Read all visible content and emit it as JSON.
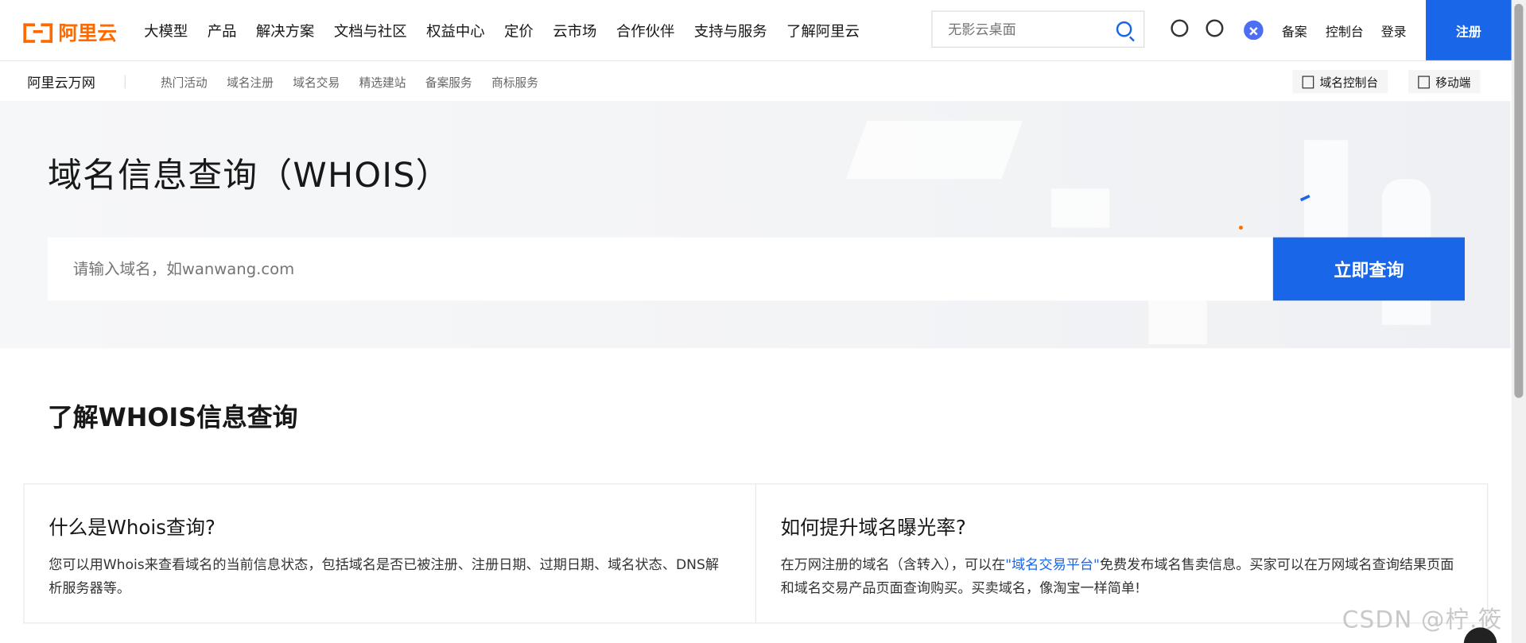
{
  "brand": {
    "name": "阿里云"
  },
  "nav": [
    "大模型",
    "产品",
    "解决方案",
    "文档与社区",
    "权益中心",
    "定价",
    "云市场",
    "合作伙伴",
    "支持与服务",
    "了解阿里云"
  ],
  "search": {
    "placeholder": "无影云桌面"
  },
  "toplinks": {
    "beian": "备案",
    "console": "控制台",
    "login": "登录",
    "signup": "注册"
  },
  "subbar": {
    "brand": "阿里云万网",
    "items": [
      "热门活动",
      "域名注册",
      "域名交易",
      "精选建站",
      "备案服务",
      "商标服务"
    ],
    "domain_console": "域名控制台",
    "mobile": "移动端"
  },
  "hero": {
    "title": "域名信息查询（WHOIS）",
    "placeholder": "请输入域名，如wanwang.com",
    "button": "立即查询"
  },
  "section": {
    "title": "了解WHOIS信息查询"
  },
  "cards": [
    {
      "title": "什么是Whois查询?",
      "text": "您可以用Whois来查看域名的当前信息状态，包括域名是否已被注册、注册日期、过期日期、域名状态、DNS解析服务器等。"
    },
    {
      "title": "如何提升域名曝光率?",
      "text_before": "在万网注册的域名（含转入），可以在",
      "link": "\"域名交易平台\"",
      "text_after": "免费发布域名售卖信息。买家可以在万网域名查询结果页面和域名交易产品页面查询购买。买卖域名，像淘宝一样简单!"
    }
  ],
  "watermark": "CSDN @柠.筱",
  "colors": {
    "accent": "#1a66e8",
    "brand": "#ff6a00"
  }
}
